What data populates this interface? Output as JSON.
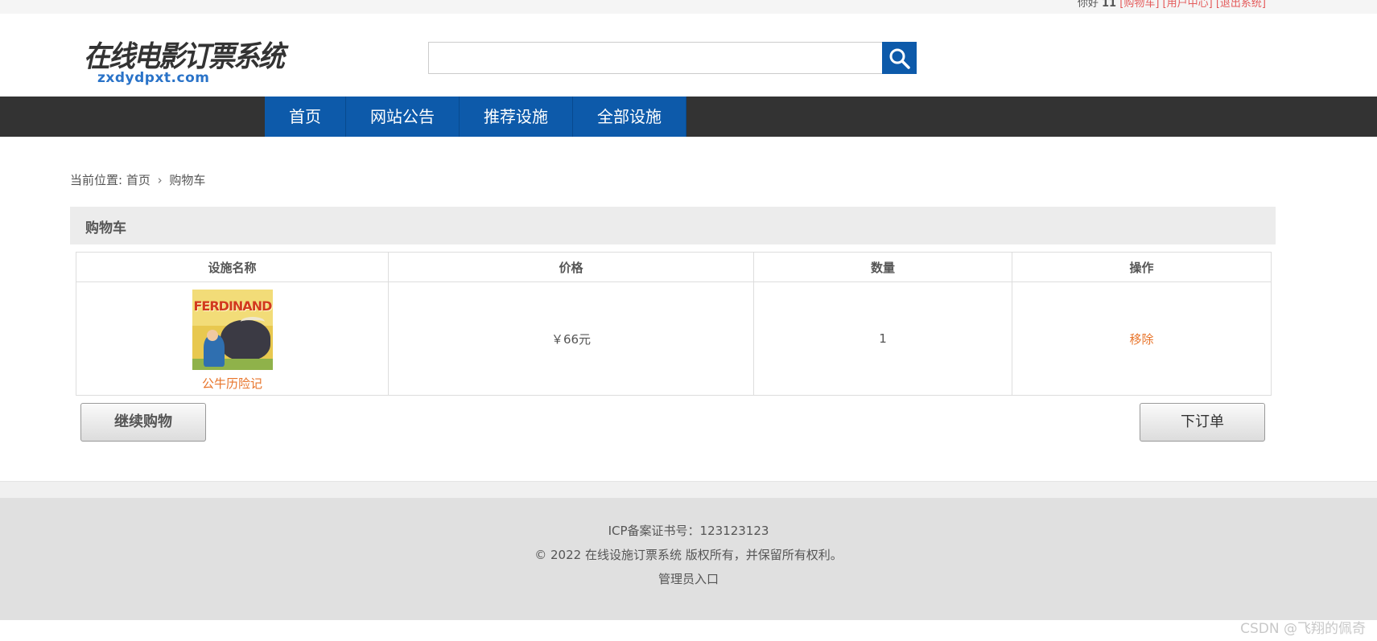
{
  "topbar": {
    "greeting": "你好 ",
    "username": "11",
    "links": [
      "[购物车]",
      "[用户中心]",
      "[退出系统]"
    ]
  },
  "header": {
    "logo_cn": "在线电影订票系统",
    "logo_en": "zxdydpxt.com",
    "search": {
      "value": "",
      "placeholder": ""
    },
    "search_icon": "search-icon"
  },
  "nav": {
    "items": [
      "首页",
      "网站公告",
      "推荐设施",
      "全部设施"
    ],
    "active_color": "#0d5aaa",
    "bar_color": "#333333"
  },
  "breadcrumb": {
    "prefix": "当前位置:",
    "home": "首页",
    "current": "购物车"
  },
  "cart": {
    "heading": "购物车",
    "columns": [
      "设施名称",
      "价格",
      "数量",
      "操作"
    ],
    "rows": [
      {
        "name": "公牛历险记",
        "poster_title": "FERDINAND",
        "price": "￥66元",
        "quantity": "1",
        "action": "移除"
      }
    ],
    "continue_label": "继续购物",
    "order_label": "下订单"
  },
  "footer": {
    "icp": "ICP备案证书号：123123123",
    "copyright": "© 2022 在线设施订票系统 版权所有，并保留所有权利。",
    "admin": "管理员入口"
  },
  "watermark": "CSDN @飞翔的佩奇"
}
